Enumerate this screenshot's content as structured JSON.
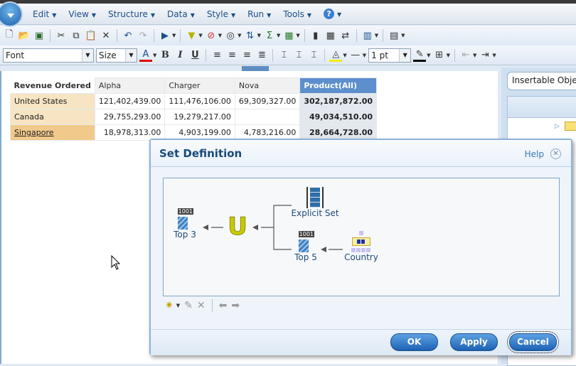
{
  "menu": {
    "items": [
      "Edit",
      "View",
      "Structure",
      "Data",
      "Style",
      "Run",
      "Tools"
    ]
  },
  "toolbar": {
    "font_value": "Font",
    "size_value": "Size",
    "line_width_value": "1 pt"
  },
  "right_panel": {
    "title": "Insertable Objects"
  },
  "table": {
    "corner": "Revenue Ordered",
    "columns": [
      "Alpha",
      "Charger",
      "Nova",
      "Product(All)"
    ],
    "rows": [
      {
        "label": "United States",
        "values": [
          "121,402,439.00",
          "111,476,106.00",
          "69,309,327.00"
        ],
        "total": "302,187,872.00"
      },
      {
        "label": "Canada",
        "values": [
          "29,755,293.00",
          "19,279,217.00",
          ""
        ],
        "total": "49,034,510.00"
      },
      {
        "label": "Singapore",
        "values": [
          "18,978,313.00",
          "4,903,199.00",
          "4,783,216.00"
        ],
        "total": "28,664,728.00"
      }
    ]
  },
  "dialog": {
    "title": "Set Definition",
    "help": "Help",
    "nodes": {
      "top3": "Top 3",
      "explicit": "Explicit Set",
      "top5": "Top 5",
      "country": "Country",
      "badge": "1001"
    },
    "buttons": {
      "ok": "OK",
      "apply": "Apply",
      "cancel": "Cancel"
    }
  },
  "colors": {
    "accent": "#1d62b4",
    "header_blue": "#5d8fcc",
    "row_label": "#f6e4c3",
    "selected_row": "#f1c98b"
  }
}
